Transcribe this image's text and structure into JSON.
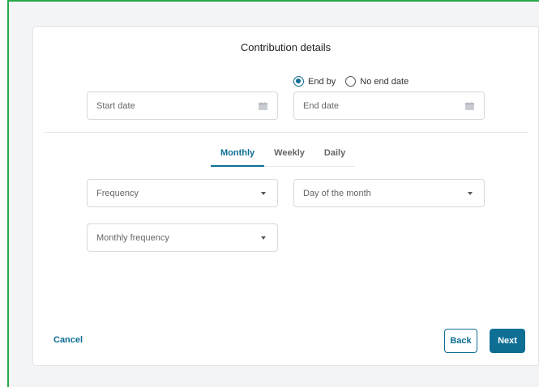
{
  "title": "Contribution details",
  "end_options": [
    {
      "label": "End by",
      "checked": true
    },
    {
      "label": "No end date",
      "checked": false
    }
  ],
  "fields": {
    "start_date": {
      "placeholder": "Start date",
      "icon": "calendar-icon"
    },
    "end_date": {
      "placeholder": "End date",
      "icon": "calendar-icon"
    },
    "frequency": {
      "placeholder": "Frequency",
      "icon": "caret-down-icon"
    },
    "day_of_month": {
      "placeholder": "Day of the month",
      "icon": "caret-down-icon"
    },
    "monthly_frequency": {
      "placeholder": "Monthly frequency",
      "icon": "caret-down-icon"
    }
  },
  "tabs": [
    {
      "label": "Monthly",
      "active": true
    },
    {
      "label": "Weekly",
      "active": false
    },
    {
      "label": "Daily",
      "active": false
    }
  ],
  "actions": {
    "cancel": "Cancel",
    "back": "Back",
    "next": "Next"
  },
  "colors": {
    "accent": "#0e6e93",
    "frame_border": "#2aa84a",
    "background": "#f3f4f6"
  }
}
